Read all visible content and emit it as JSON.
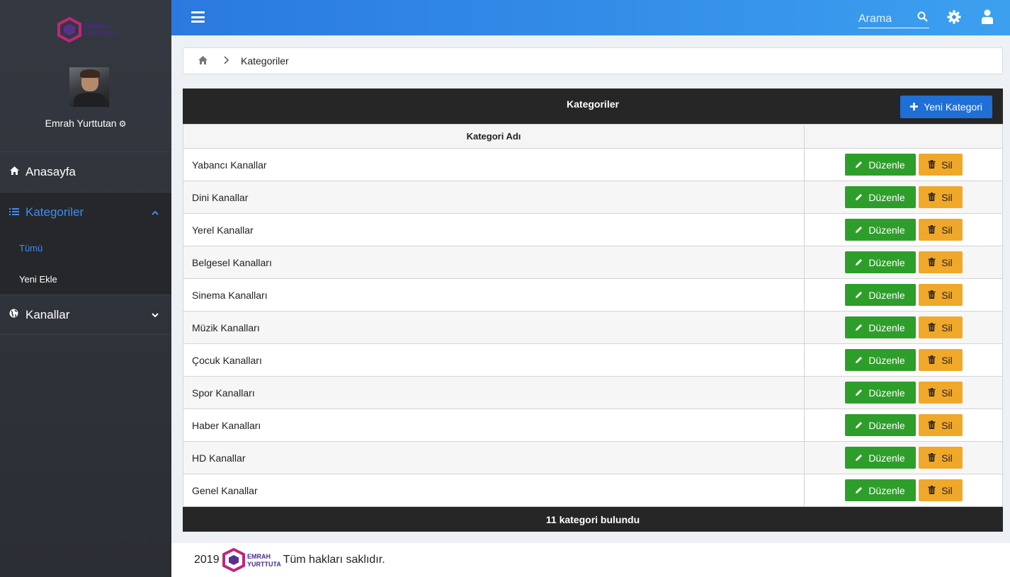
{
  "brand": {
    "logo_text_line1": "EMRAH",
    "logo_text_line2": "YURTTUTAN",
    "primary_color": "#2a79e0",
    "accent_pink": "#c0267a",
    "accent_purple": "#4a2a8a"
  },
  "sidebar": {
    "user_name": "Emrah Yurttutan",
    "nav": [
      {
        "label": "Anasayfa",
        "icon": "home-icon"
      },
      {
        "label": "Kategoriler",
        "icon": "list-icon",
        "sub": [
          "Tümü",
          "Yeni Ekle"
        ]
      },
      {
        "label": "Kanallar",
        "icon": "globe-icon"
      }
    ]
  },
  "topbar": {
    "search_placeholder": "Arama"
  },
  "breadcrumb": {
    "current": "Kategoriler"
  },
  "panel": {
    "title": "Kategoriler",
    "new_button": "Yeni Kategori",
    "column_name": "Kategori Adı",
    "column_actions": "",
    "edit_label": "Düzenle",
    "delete_label": "Sil",
    "rows": [
      "Yabancı Kanallar",
      "Dini Kanallar",
      "Yerel Kanallar",
      "Belgesel Kanalları",
      "Sinema Kanalları",
      "Müzik Kanalları",
      "Çocuk Kanalları",
      "Spor Kanalları",
      "Haber Kanalları",
      "HD Kanallar",
      "Genel Kanallar"
    ],
    "footer": "11 kategori bulundu"
  },
  "footer": {
    "year": "2019",
    "text": "Tüm hakları saklıdır."
  }
}
